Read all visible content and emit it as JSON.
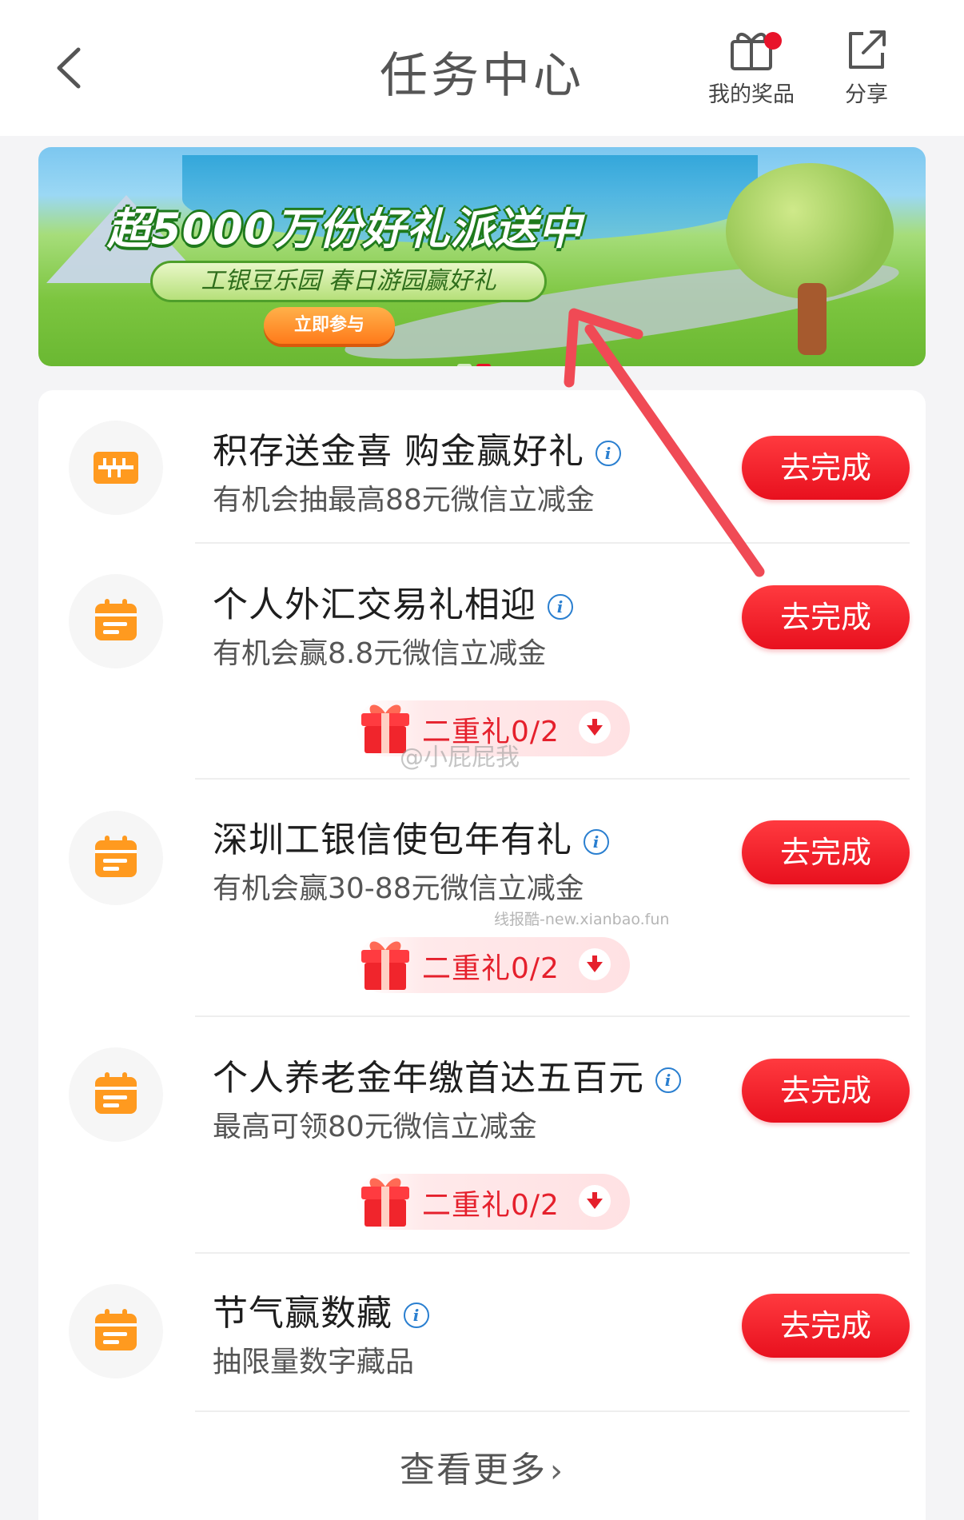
{
  "header": {
    "title": "任务中心",
    "my_prizes_label": "我的奖品",
    "share_label": "分享"
  },
  "banner": {
    "headline": "超5000万份好礼派送中",
    "subtitle": "工银豆乐园 春日游园赢好礼",
    "cta": "立即参与"
  },
  "tasks": [
    {
      "icon": "ruler-icon",
      "title": "积存送金喜 购金赢好礼",
      "desc": "有机会抽最高88元微信立减金",
      "button": "去完成"
    },
    {
      "icon": "calendar-icon",
      "title": "个人外汇交易礼相迎",
      "desc": "有机会赢8.8元微信立减金",
      "button": "去完成",
      "gift": "二重礼0/2"
    },
    {
      "icon": "calendar-icon",
      "title": "深圳工银信使包年有礼",
      "desc": "有机会赢30-88元微信立减金",
      "button": "去完成",
      "gift": "二重礼0/2"
    },
    {
      "icon": "calendar-icon",
      "title": "个人养老金年缴首达五百元",
      "desc": "最高可领80元微信立减金",
      "button": "去完成",
      "gift": "二重礼0/2"
    },
    {
      "icon": "calendar-icon",
      "title": "节气赢数藏",
      "desc": "抽限量数字藏品",
      "button": "去完成"
    }
  ],
  "info_glyph": "i",
  "more_label": "查看更多",
  "more_chevron": "›",
  "watermarks": {
    "weibo": "@小屁屁我",
    "site": "线报酷-new.xianbao.fun"
  },
  "colors": {
    "accent_red": "#e8101e",
    "icon_orange": "#ff9a1f",
    "info_blue": "#2a7fd0"
  }
}
